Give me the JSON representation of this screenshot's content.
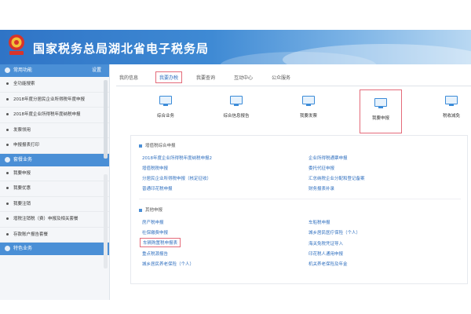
{
  "header": {
    "title": "国家税务总局湖北省电子税务局"
  },
  "sidebar": {
    "sections": [
      {
        "title": "常用功能",
        "more": "设置",
        "items": [
          "全功能搜索",
          "2018年度分居民企业所得税年度申报",
          "2018年度企业所得税年度纳税申报",
          "发票领用",
          "申报报表打印"
        ]
      },
      {
        "title": "套餐业务",
        "items": [
          "我要申报",
          "我要优惠",
          "我要注销",
          "增税注销税（费）申报及相关套餐",
          "存款账户报告套餐"
        ]
      },
      {
        "title": "特色业务",
        "items": []
      }
    ]
  },
  "tabs": [
    "我的信息",
    "我要办税",
    "我要查询",
    "互动中心",
    "公众服务"
  ],
  "active_tab": "我要办税",
  "icons": [
    {
      "label": "综合业务",
      "icon": "monitor-icon"
    },
    {
      "label": "综合信息报告",
      "icon": "monitor-icon"
    },
    {
      "label": "我要发票",
      "icon": "monitor-icon"
    },
    {
      "label": "我要申报",
      "icon": "monitor-icon",
      "highlighted": true
    },
    {
      "label": "税收减免",
      "icon": "monitor-icon"
    }
  ],
  "groups": [
    {
      "title": "增值税综合申报",
      "left": [
        "2018年度企业所得税年度纳税申报2",
        "增值税税申报",
        "分居民企业所得税申报（核定征收）",
        "普通印花税申报"
      ],
      "right": [
        "企业所得税通票申报",
        "委托代征申报",
        "汇总纳税企业分配和登记备案",
        "财务报表补录"
      ]
    },
    {
      "title": "其他申报",
      "left": [
        "房产税申报",
        "社保缴费申报",
        "车辆购置税申报表",
        "重点税源报告",
        "城乡居民养老保险（个人）"
      ],
      "right": [
        "车船税申报",
        "城乡居民医疗保险（个人）",
        "海关免税凭证导入",
        "印花税人通用申报",
        "机关养老保险及年金"
      ],
      "highlight_left_index": 2
    }
  ],
  "colors": {
    "header_start": "#2f74c6",
    "accent": "#4a8fd6",
    "highlight": "#e46b7a",
    "link": "#2f6fbf"
  }
}
